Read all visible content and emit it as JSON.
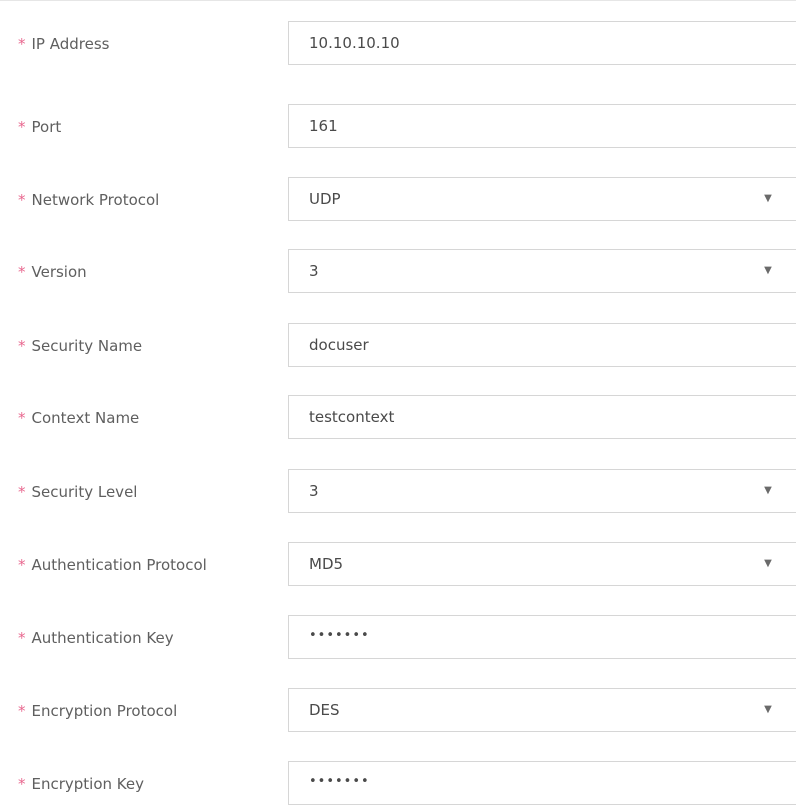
{
  "form": {
    "required_marker": "*",
    "fields": [
      {
        "label": "IP Address",
        "value": "10.10.10.10",
        "type": "text"
      },
      {
        "label": "Port",
        "value": "161",
        "type": "text"
      },
      {
        "label": "Network Protocol",
        "value": "UDP",
        "type": "select"
      },
      {
        "label": "Version",
        "value": "3",
        "type": "select"
      },
      {
        "label": "Security Name",
        "value": "docuser",
        "type": "text"
      },
      {
        "label": "Context Name",
        "value": "testcontext",
        "type": "text"
      },
      {
        "label": "Security Level",
        "value": "3",
        "type": "select"
      },
      {
        "label": "Authentication Protocol",
        "value": "MD5",
        "type": "select"
      },
      {
        "label": "Authentication Key",
        "value": "•••••••",
        "type": "password"
      },
      {
        "label": "Encryption Protocol",
        "value": "DES",
        "type": "select"
      },
      {
        "label": "Encryption Key",
        "value": "•••••••",
        "type": "password"
      }
    ],
    "dropdown_icon": "▼"
  },
  "colors": {
    "required": "#e8688f",
    "label": "#5f5f5f",
    "value": "#4a4a4a",
    "border": "#d6d6d6"
  }
}
